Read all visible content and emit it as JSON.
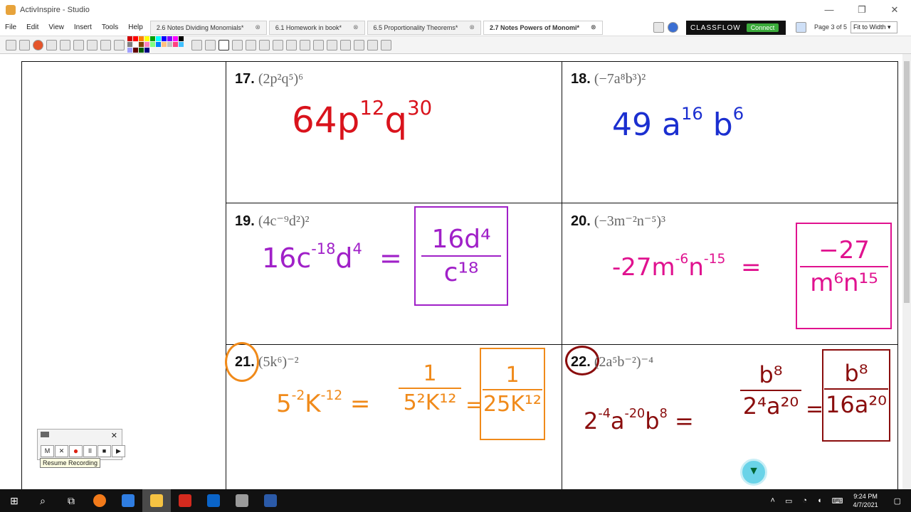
{
  "window": {
    "title": "ActivInspire - Studio"
  },
  "menu": [
    "File",
    "Edit",
    "View",
    "Insert",
    "Tools",
    "Help"
  ],
  "tabs": [
    {
      "label": "2.6 Notes Dividing Monomials*",
      "active": false
    },
    {
      "label": "6.1 Homework in book*",
      "active": false
    },
    {
      "label": "6.5 Proportionality Theorems*",
      "active": false
    },
    {
      "label": "2.7 Notes Powers of Monomi*",
      "active": true
    }
  ],
  "classflow": {
    "brand": "CLASSFLOW",
    "connect": "Connect"
  },
  "page_info": "Page 3 of 5",
  "zoom": "Fit to Width",
  "palette": [
    "#d00000",
    "#ff0000",
    "#ff8000",
    "#ffff00",
    "#00a000",
    "#00ffff",
    "#0000ff",
    "#8000ff",
    "#ff00ff",
    "#000000",
    "#808080",
    "#ffffff",
    "#804000",
    "#ff80c0",
    "#80ff80",
    "#0080ff",
    "#ffc080",
    "#c0c0c0",
    "#ff4080",
    "#40c0ff",
    "#a0a0ff",
    "#600000",
    "#006000",
    "#000080"
  ],
  "problems": [
    {
      "num": "17.",
      "expr": "(2p²q⁵)⁶",
      "answer": {
        "coef": "64",
        "terms": [
          {
            "b": "p",
            "e": "12"
          },
          {
            "b": "q",
            "e": "30"
          }
        ]
      },
      "color": "#d9131c"
    },
    {
      "num": "18.",
      "expr": "(−7a⁸b³)²",
      "answer": {
        "coef": "49",
        "terms": [
          {
            "b": "a",
            "e": "16"
          },
          {
            "b": "b",
            "e": "6"
          }
        ]
      },
      "color": "#1b2fd0"
    },
    {
      "num": "19.",
      "expr": "(4c⁻⁹d²)²",
      "work": {
        "coef": "16",
        "terms": [
          {
            "b": "c",
            "e": "-18"
          },
          {
            "b": "d",
            "e": "4"
          }
        ]
      },
      "boxed": {
        "num": "16d⁴",
        "den": "c¹⁸"
      },
      "color": "#a020c8"
    },
    {
      "num": "20.",
      "expr": "(−3m⁻²n⁻⁵)³",
      "work": {
        "coef": "-27",
        "terms": [
          {
            "b": "m",
            "e": "-6"
          },
          {
            "b": "n",
            "e": "-15"
          }
        ]
      },
      "boxed": {
        "num": "−27",
        "den": "m⁶n¹⁵"
      },
      "color": "#e0128f"
    },
    {
      "num": "21.",
      "expr": "(5k⁶)⁻²",
      "work": {
        "coef": "5",
        "e1": "-2",
        "var": "K",
        "e2": "-12"
      },
      "mid": {
        "num": "1",
        "den": "5²K¹²"
      },
      "boxed": {
        "num": "1",
        "den": "25K¹²"
      },
      "color": "#f08a1a"
    },
    {
      "num": "22.",
      "expr": "(2a⁵b⁻²)⁻⁴",
      "work": {
        "coef": "2",
        "e1": "-4",
        "terms": [
          {
            "b": "a",
            "e": "-20"
          },
          {
            "b": "b",
            "e": "8"
          }
        ]
      },
      "mid": {
        "num": "b⁸",
        "den": "2⁴a²⁰"
      },
      "boxed": {
        "num": "b⁸",
        "den": "16a²⁰"
      },
      "color": "#8a0d0d"
    }
  ],
  "recorder": {
    "buttons": [
      "M",
      "✕",
      "●",
      "II",
      "■",
      "▶"
    ],
    "tooltip": "Resume Recording"
  },
  "clock": {
    "time": "9:24 PM",
    "date": "4/7/2021"
  }
}
